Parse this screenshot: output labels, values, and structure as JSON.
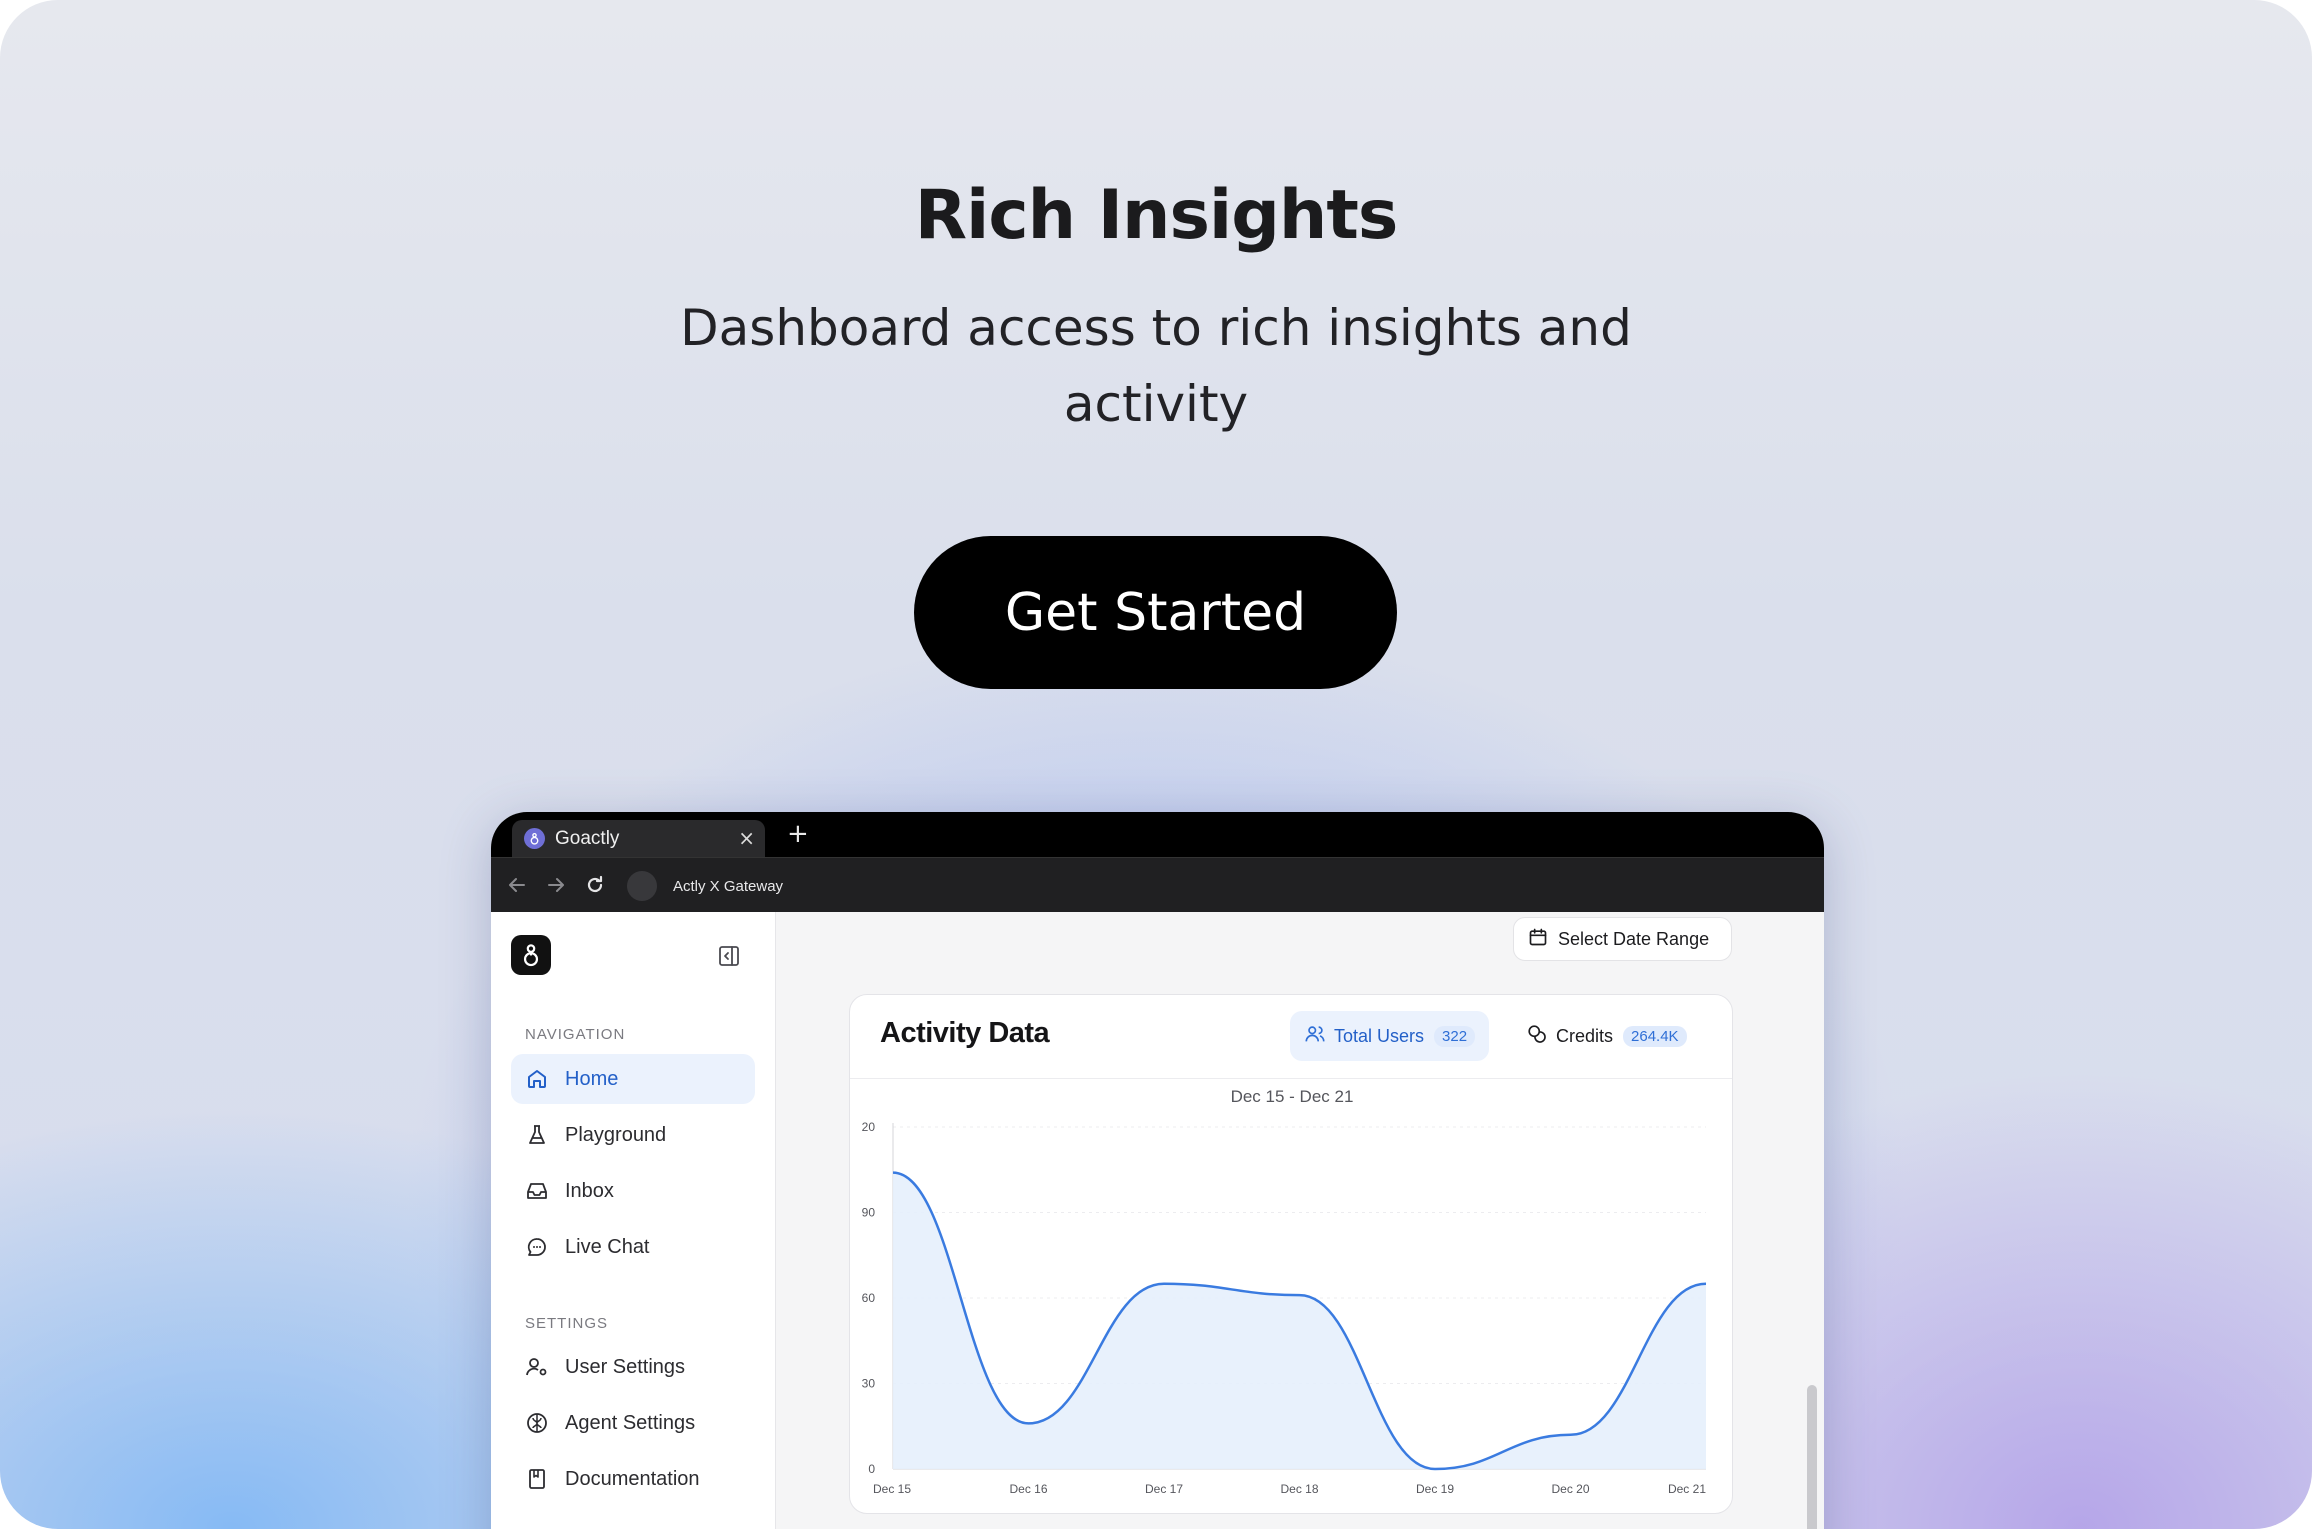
{
  "hero": {
    "title": "Rich Insights",
    "subtitle": "Dashboard access to rich insights and activity",
    "cta_label": "Get Started"
  },
  "browser": {
    "tab_title": "Goactly",
    "tab_close": "×",
    "new_tab": "+",
    "url": "Actly X Gateway"
  },
  "sidebar": {
    "nav_label": "NAVIGATION",
    "settings_label": "SETTINGS",
    "nav_items": [
      {
        "label": "Home",
        "icon": "home-icon",
        "active": true
      },
      {
        "label": "Playground",
        "icon": "flask-icon"
      },
      {
        "label": "Inbox",
        "icon": "inbox-icon"
      },
      {
        "label": "Live Chat",
        "icon": "chat-icon"
      }
    ],
    "settings_items": [
      {
        "label": "User Settings",
        "icon": "user-settings-icon"
      },
      {
        "label": "Agent Settings",
        "icon": "brain-icon"
      },
      {
        "label": "Documentation",
        "icon": "book-icon"
      }
    ]
  },
  "main": {
    "date_range_label": "Select Date Range",
    "card_title": "Activity Data",
    "total_users_label": "Total Users",
    "total_users_value": "322",
    "credits_label": "Credits",
    "credits_value": "264.4K",
    "range_label": "Dec 15 - Dec 21"
  },
  "colors": {
    "accent": "#2f6fd6",
    "line": "#3a7be0",
    "area": "#e6effc"
  },
  "chart_data": {
    "type": "area",
    "title": "Dec 15 - Dec 21",
    "categories": [
      "Dec 15",
      "Dec 16",
      "Dec 17",
      "Dec 18",
      "Dec 19",
      "Dec 20",
      "Dec 21"
    ],
    "y_tick_labels": [
      "0",
      "30",
      "60",
      "90",
      "20"
    ],
    "series": [
      {
        "values": [
          104,
          16,
          65,
          61,
          0,
          12,
          65
        ]
      }
    ],
    "ylim": [
      0,
      120
    ],
    "grid": true
  }
}
